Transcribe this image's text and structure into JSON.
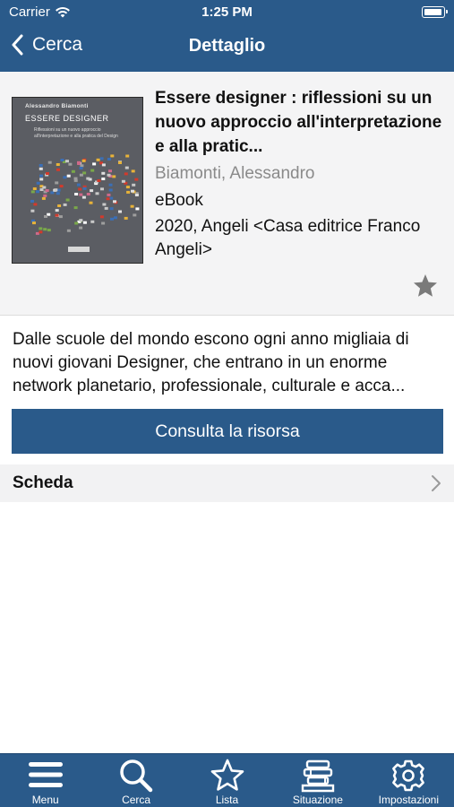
{
  "status_bar": {
    "carrier": "Carrier",
    "time": "1:25 PM",
    "icons": [
      "wifi-icon",
      "battery-icon"
    ]
  },
  "nav": {
    "back_label": "Cerca",
    "title": "Dettaglio"
  },
  "book": {
    "title": "Essere designer : riflessioni su un nuovo approccio all'interpretazione e alla pratic...",
    "author": "Biamonti, Alessandro",
    "type": "eBook",
    "publication": "2020, Angeli <Casa editrice Franco Angeli>",
    "cover": {
      "author": "Alessandro Biamonti",
      "title": "ESSERE DESIGNER",
      "subtitle": "Riflessioni su un nuovo approccio all'interpretazione e alla pratica del Design"
    },
    "favorite_icon": "star-icon",
    "favorite": false
  },
  "abstract": "Dalle scuole del mondo escono ogni anno migliaia di nuovi giovani Designer, che entrano in un enorme network planetario, professionale, culturale e acca...",
  "actions": {
    "consult_label": "Consulta la risorsa"
  },
  "sections": {
    "scheda_label": "Scheda"
  },
  "tabbar": [
    {
      "label": "Menu",
      "icon": "menu-icon"
    },
    {
      "label": "Cerca",
      "icon": "search-icon"
    },
    {
      "label": "Lista",
      "icon": "star-icon"
    },
    {
      "label": "Situazione",
      "icon": "books-icon"
    },
    {
      "label": "Impostazioni",
      "icon": "gear-icon"
    }
  ],
  "colors": {
    "primary": "#2a5a8a",
    "favorite": "#7a7a7a",
    "card_background": "#f4f4f5"
  }
}
